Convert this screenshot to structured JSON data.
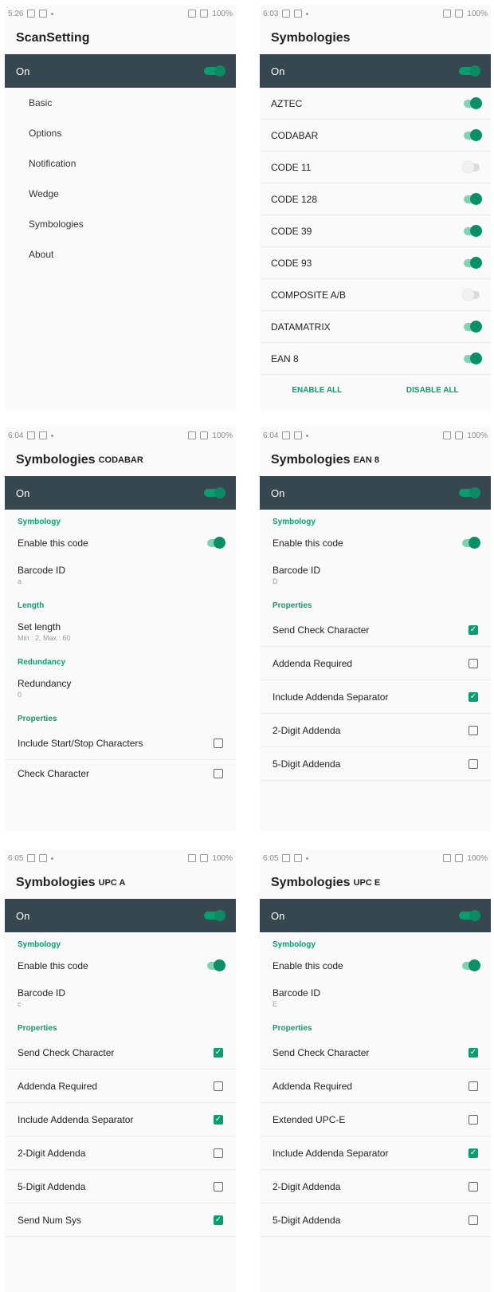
{
  "status": {
    "p1_time": "5:26",
    "p2_time": "6:03",
    "p3_time": "6:04",
    "p4_time": "6:04",
    "p5_time": "6:05",
    "p6_time": "6:05",
    "battery": "100%"
  },
  "accent_color": "#0a9d6f",
  "appbar_color": "#37474f",
  "scansetting": {
    "title": "ScanSetting",
    "on_label": "On",
    "menu": [
      "Basic",
      "Options",
      "Notification",
      "Wedge",
      "Symbologies",
      "About"
    ]
  },
  "symbologies": {
    "title": "Symbologies",
    "on_label": "On",
    "items": [
      {
        "label": "AZTEC",
        "enabled": true
      },
      {
        "label": "CODABAR",
        "enabled": true
      },
      {
        "label": "CODE 11",
        "enabled": false
      },
      {
        "label": "CODE 128",
        "enabled": true
      },
      {
        "label": "CODE 39",
        "enabled": true
      },
      {
        "label": "CODE 93",
        "enabled": true
      },
      {
        "label": "COMPOSITE A/B",
        "enabled": false
      },
      {
        "label": "DATAMATRIX",
        "enabled": true
      },
      {
        "label": "EAN 8",
        "enabled": true
      }
    ],
    "enable_all": "ENABLE ALL",
    "disable_all": "DISABLE ALL"
  },
  "codabar": {
    "title": "Symbologies",
    "subtitle": "CODABAR",
    "on_label": "On",
    "symbology_header": "Symbology",
    "enable_label": "Enable this code",
    "barcode_id_label": "Barcode ID",
    "barcode_id_value": "a",
    "length_header": "Length",
    "set_length_label": "Set length",
    "set_length_value": "Min : 2, Max : 60",
    "redundancy_header": "Redundancy",
    "redundancy_label": "Redundancy",
    "redundancy_value": "0",
    "properties_header": "Properties",
    "start_stop_label": "Include Start/Stop Characters",
    "check_char_label": "Check Character"
  },
  "ean8": {
    "title": "Symbologies",
    "subtitle": "EAN 8",
    "on_label": "On",
    "symbology_header": "Symbology",
    "enable_label": "Enable this code",
    "barcode_id_label": "Barcode ID",
    "barcode_id_value": "D",
    "properties_header": "Properties",
    "props": [
      {
        "label": "Send Check Character",
        "checked": true
      },
      {
        "label": "Addenda Required",
        "checked": false
      },
      {
        "label": "Include Addenda Separator",
        "checked": true
      },
      {
        "label": "2-Digit Addenda",
        "checked": false
      },
      {
        "label": "5-Digit Addenda",
        "checked": false
      }
    ]
  },
  "upca": {
    "title": "Symbologies",
    "subtitle": "UPC A",
    "on_label": "On",
    "symbology_header": "Symbology",
    "enable_label": "Enable this code",
    "barcode_id_label": "Barcode ID",
    "barcode_id_value": "c",
    "properties_header": "Properties",
    "props": [
      {
        "label": "Send Check Character",
        "checked": true
      },
      {
        "label": "Addenda Required",
        "checked": false
      },
      {
        "label": "Include Addenda Separator",
        "checked": true
      },
      {
        "label": "2-Digit Addenda",
        "checked": false
      },
      {
        "label": "5-Digit Addenda",
        "checked": false
      },
      {
        "label": "Send Num Sys",
        "checked": true
      }
    ]
  },
  "upce": {
    "title": "Symbologies",
    "subtitle": "UPC E",
    "on_label": "On",
    "symbology_header": "Symbology",
    "enable_label": "Enable this code",
    "barcode_id_label": "Barcode ID",
    "barcode_id_value": "E",
    "properties_header": "Properties",
    "props": [
      {
        "label": "Send Check Character",
        "checked": true
      },
      {
        "label": "Addenda Required",
        "checked": false
      },
      {
        "label": "Extended UPC-E",
        "checked": false
      },
      {
        "label": "Include Addenda Separator",
        "checked": true
      },
      {
        "label": "2-Digit Addenda",
        "checked": false
      },
      {
        "label": "5-Digit Addenda",
        "checked": false
      }
    ]
  }
}
